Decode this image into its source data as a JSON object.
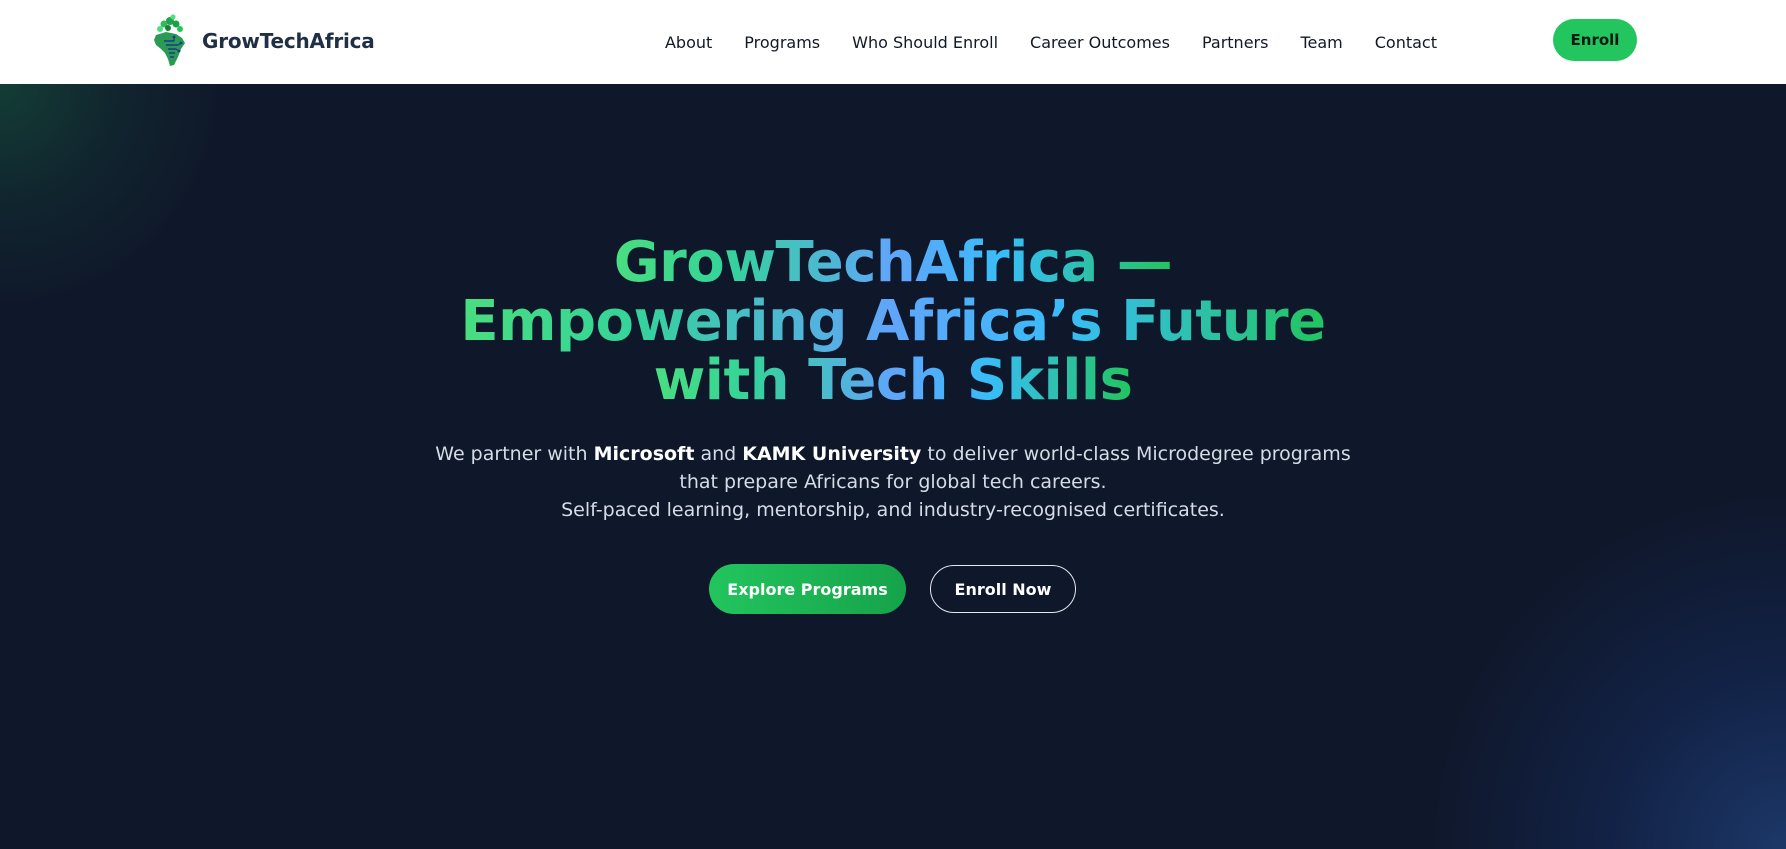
{
  "brand": {
    "name": "GrowTechAfrica",
    "logo_icon": "africa-tree-logo-icon"
  },
  "nav": {
    "items": [
      {
        "label": "About"
      },
      {
        "label": "Programs"
      },
      {
        "label": "Who Should Enroll"
      },
      {
        "label": "Career Outcomes"
      },
      {
        "label": "Partners"
      },
      {
        "label": "Team"
      },
      {
        "label": "Contact"
      }
    ],
    "enroll_label": "Enroll"
  },
  "hero": {
    "title_lines": [
      "GrowTechAfrica —",
      "Empowering Africa’s Future",
      "with Tech Skills"
    ],
    "subtitle": {
      "part1": "We partner with ",
      "partner1": "Microsoft",
      "part2": " and ",
      "partner2": "KAMK University",
      "part3": " to deliver world-class Microdegree programs",
      "line2": "that prepare Africans for global tech careers.",
      "line3": "Self-paced learning, mentorship, and industry-recognised certificates."
    },
    "primary_cta": "Explore Programs",
    "secondary_cta": "Enroll Now"
  },
  "colors": {
    "header_bg": "#ffffff",
    "hero_bg": "#0f172a",
    "accent_green": "#22c55e",
    "accent_blue": "#60a5fa",
    "brand_text": "#1f2f46"
  }
}
